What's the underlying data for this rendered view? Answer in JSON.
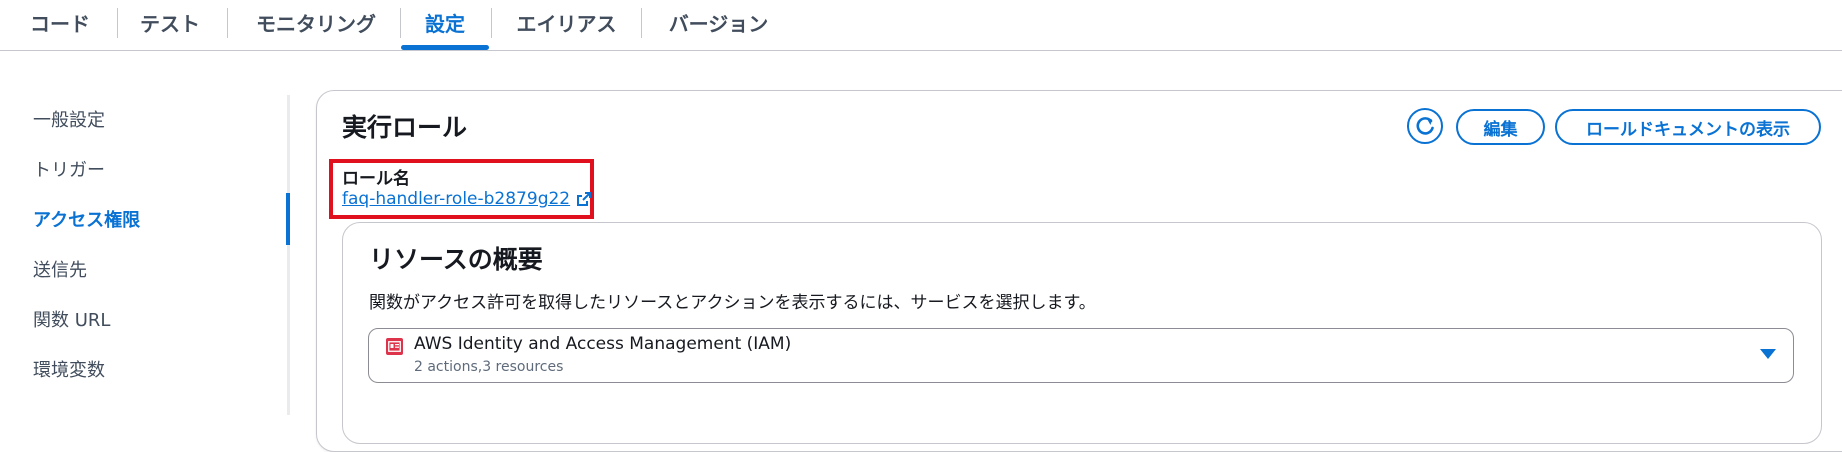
{
  "tabs": [
    {
      "label": "コード"
    },
    {
      "label": "テスト"
    },
    {
      "label": "モニタリング"
    },
    {
      "label": "設定",
      "active": true
    },
    {
      "label": "エイリアス"
    },
    {
      "label": "バージョン"
    }
  ],
  "sidenav": {
    "items": [
      {
        "label": "一般設定"
      },
      {
        "label": "トリガー"
      },
      {
        "label": "アクセス権限",
        "active": true
      },
      {
        "label": "送信先"
      },
      {
        "label": "関数 URL"
      },
      {
        "label": "環境変数"
      }
    ]
  },
  "execution_role": {
    "title": "実行ロール",
    "edit_label": "編集",
    "view_doc_label": "ロールドキュメントの表示",
    "role_name_label": "ロール名",
    "role_name": "faq-handler-role-b2879g22"
  },
  "resource_summary": {
    "title": "リソースの概要",
    "description": "関数がアクセス許可を取得したリソースとアクションを表示するには、サービスを選択します。",
    "selected_service": {
      "name": "AWS Identity and Access Management (IAM)",
      "detail": "2 actions,3 resources"
    }
  },
  "colors": {
    "accent": "#0972d3",
    "highlight": "#e0101e",
    "iam_icon": "#dd344c"
  }
}
